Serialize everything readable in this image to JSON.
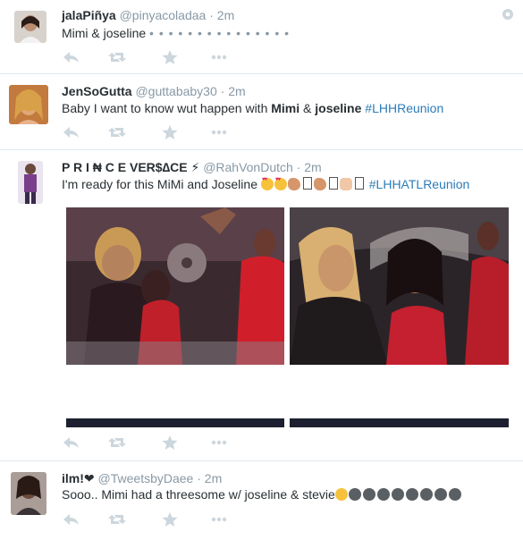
{
  "tweets": [
    {
      "fullname": "jalaPiñya",
      "handle": "@pinyacoladaa",
      "sep": "·",
      "time": "2m",
      "text": "Mimi & joseline",
      "dots": "• • • • • • • • • • • • • • •"
    },
    {
      "fullname": "JenSoGutta",
      "handle": "@guttababy30",
      "sep": "·",
      "time": "2m",
      "text_pre": "Baby I want to know wut happen with ",
      "bold1": "Mimi",
      "amp": " & ",
      "bold2": "joseline",
      "hashtag": "#LHHReunion"
    },
    {
      "fullname": "P R I ₦ C E  VER$∆CE ⚡",
      "handle": "@RahVonDutch",
      "sep": "·",
      "time": "2m",
      "text": "I'm ready for this MiMi and Joseline",
      "hashtag": "#LHHATLReunion"
    },
    {
      "fullname": "ilm!❤",
      "handle": "@TweetsbyDaee",
      "sep": "·",
      "time": "2m",
      "text": "Sooo.. Mimi had a threesome w/ joseline & stevie"
    }
  ],
  "icons": {
    "reply": "reply-icon",
    "retweet": "retweet-icon",
    "favorite": "star-icon",
    "more": "more-icon",
    "settings": "gear-icon"
  },
  "colors": {
    "text": "#292f33",
    "muted": "#8899a6",
    "hashtag": "#2b7bb9",
    "action": "#ccd6dd",
    "divider": "#e1e8ed"
  }
}
